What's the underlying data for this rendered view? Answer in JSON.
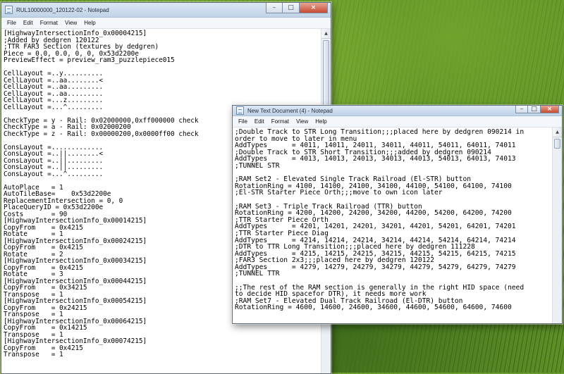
{
  "window1": {
    "title": "RUL10000000_120122-02 - Notepad",
    "menu": [
      "File",
      "Edit",
      "Format",
      "View",
      "Help"
    ],
    "lines": [
      "[HighwayIntersectionInfo_0x00004215]",
      ";Added by dedgren 120122",
      ";TTR FAR3 Section (textures by dedgren)",
      "Piece = 0.0, 0.0, 0, 0, 0x53d2200e",
      "PreviewEffect = preview_ram3_puzzlepiece015",
      "",
      "CellLayout =..y..........",
      "CellLayout =..aa........<",
      "CellLayout =..aa.........",
      "CellLayout =..aa.........",
      "CellLayout =...z.........",
      "CellLayout =...^.........",
      "",
      "CheckType = y - Rail: 0x02000000,0xff000000 check",
      "CheckType = a - Rail: 0x02000200",
      "CheckType = z - Rail: 0x00000200,0x0000ff00 check",
      "",
      "ConsLayout =.............",
      "ConsLayout =..||........<",
      "ConsLayout =..||.........",
      "ConsLayout =..||.........",
      "ConsLayout =...^.........",
      "",
      "AutoPlace   = 1",
      "AutoTileBase=    0x53d2200e",
      "ReplacementIntersection = 0, 0",
      "PlaceQueryID = 0x53d2200e",
      "Costs       = 90",
      "[HighwayIntersectionInfo_0x00014215]",
      "CopyFrom    = 0x4215",
      "Rotate      = 1",
      "[HighwayIntersectionInfo_0x00024215]",
      "CopyFrom    = 0x4215",
      "Rotate      = 2",
      "[HighwayIntersectionInfo_0x00034215]",
      "CopyFrom    = 0x4215",
      "Rotate      = 3",
      "[HighwayIntersectionInfo_0x00044215]",
      "CopyFrom    = 0x34215",
      "Transpose   = 1",
      "[HighwayIntersectionInfo_0x00054215]",
      "CopyFrom    = 0x24215",
      "Transpose   = 1",
      "[HighwayIntersectionInfo_0x00064215]",
      "CopyFrom    = 0x14215",
      "Transpose   = 1",
      "[HighwayIntersectionInfo_0x00074215]",
      "CopyFrom    = 0x4215",
      "Transpose   = 1"
    ]
  },
  "window2": {
    "title": "New Text Document (4) - Notepad",
    "menu": [
      "File",
      "Edit",
      "Format",
      "View",
      "Help"
    ],
    "lines": [
      ";Double Track to STR Long Transition;;;placed here by dedgren 090214 in",
      "order to move to later in menu",
      "AddTypes      = 4011, 14011, 24011, 34011, 44011, 54011, 64011, 74011",
      ";Double Track to STR Short Transition;;;added by dedgren 090214",
      "AddTypes      = 4013, 14013, 24013, 34013, 44013, 54013, 64013, 74013",
      ";TUNNEL STR",
      "",
      ";RAM Set2 - Elevated Single Track Railroad (El-STR) button",
      "RotationRing = 4100, 14100, 24100, 34100, 44100, 54100, 64100, 74100",
      ";El-STR Starter Piece Orth;;;move to own icon later",
      "",
      ";RAM Set3 - Triple Track Railroad (TTR) button",
      "RotationRing = 4200, 14200, 24200, 34200, 44200, 54200, 64200, 74200",
      ";TTR Starter Piece Orth",
      "AddTypes      = 4201, 14201, 24201, 34201, 44201, 54201, 64201, 74201",
      ";TTR Starter Piece Diag",
      "AddTypes      = 4214, 14214, 24214, 34214, 44214, 54214, 64214, 74214",
      ";DTR to TTR Long Transition;;;placed here by dedgren 111228",
      "AddTypes      = 4215, 14215, 24215, 34215, 44215, 54215, 64215, 74215",
      ";FAR3 Section 2x3;;;placed here by dedgren 120122",
      "AddTypes      = 4279, 14279, 24279, 34279, 44279, 54279, 64279, 74279",
      ";TUNNEL TTR",
      "",
      ";;The rest of the RAM section is generally in the right HID space (need",
      "to decide HID spacefor DTR), it needs more work",
      ";RAM Set7 - Elevated Dual Track Railroad (El-DTR) button",
      "RotationRing = 4600, 14600, 24600, 34600, 44600, 54600, 64600, 74600"
    ]
  },
  "caption": {
    "minimize": "–",
    "maximize": "□",
    "close": "×"
  },
  "scroll": {
    "up": "▲",
    "down": "▼"
  }
}
